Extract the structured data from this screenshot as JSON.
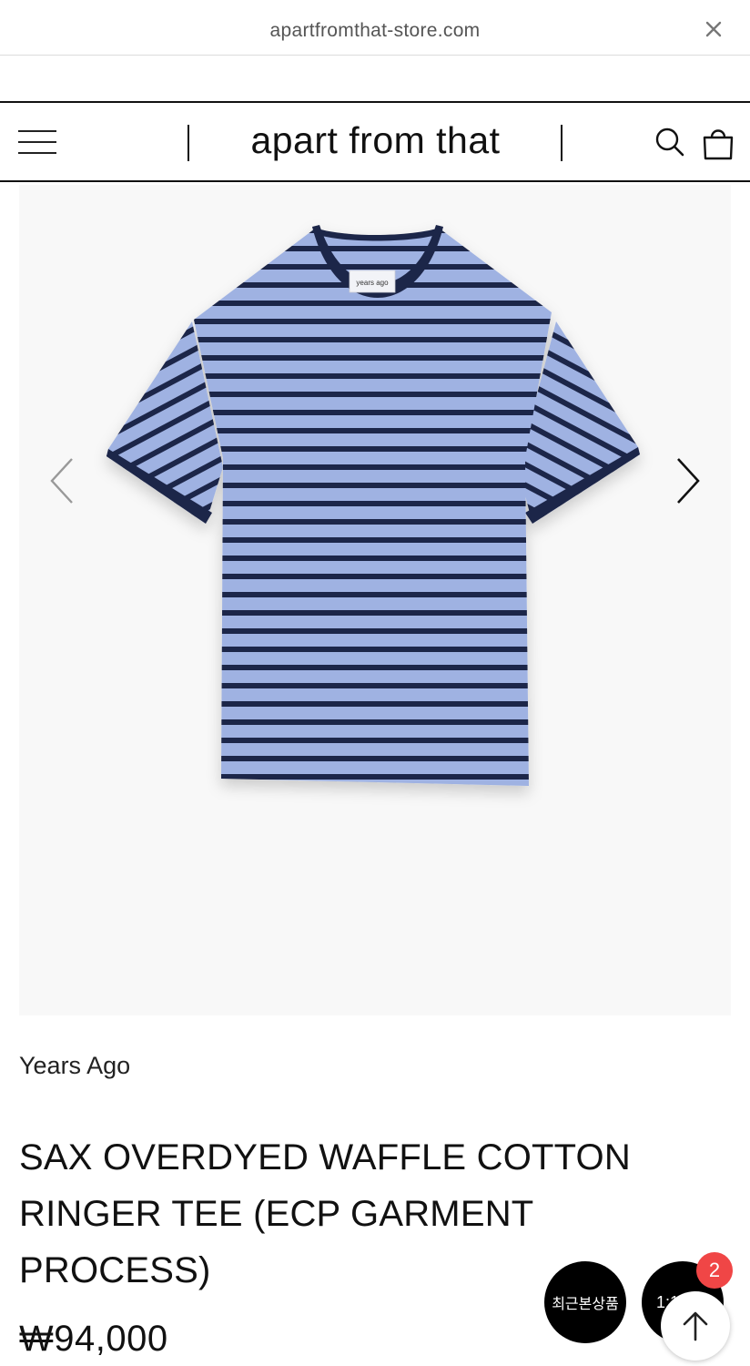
{
  "browser": {
    "url": "apartfromthat-store.com",
    "close_icon": "close-icon"
  },
  "header": {
    "menu_icon": "hamburger-menu-icon",
    "brand": "apart from that",
    "search_icon": "search-icon",
    "cart_icon": "shopping-bag-icon"
  },
  "gallery": {
    "prev_icon": "chevron-left-icon",
    "next_icon": "chevron-right-icon",
    "tag_text": "years ago"
  },
  "product": {
    "brand": "Years Ago",
    "title_lines": [
      "SAX OVERDYED WAFFLE COTTON",
      "RINGER TEE (ECP GARMENT",
      "PROCESS)"
    ],
    "price": "₩94,000"
  },
  "floating": {
    "recent_label": "최근본상품",
    "chat_label": "1:1",
    "chat_badge": "2",
    "top_icon": "arrow-up-icon"
  },
  "colors": {
    "stripe_light": "#9fb2e2",
    "stripe_dark": "#1f2648",
    "badge": "#f04646"
  }
}
